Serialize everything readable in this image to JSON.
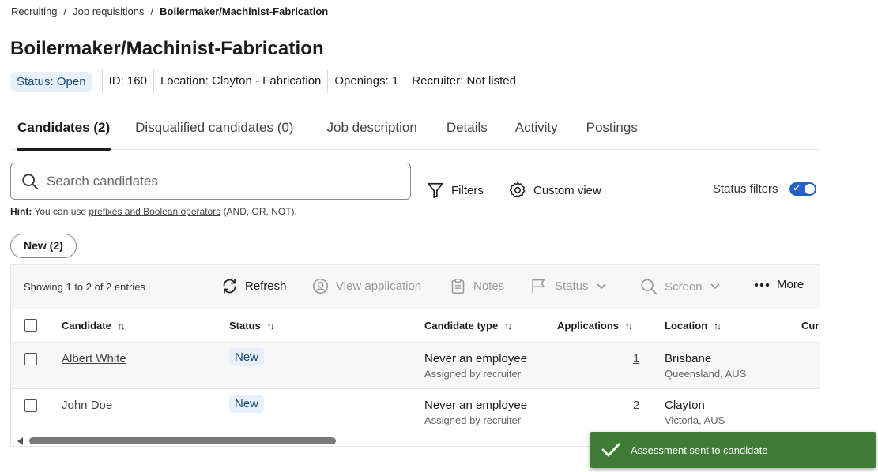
{
  "breadcrumb": {
    "items": [
      "Recruiting",
      "Job requisitions",
      "Boilermaker/Machinist-Fabrication"
    ],
    "separator": "/"
  },
  "page_title": "Boilermaker/Machinist-Fabrication",
  "meta": {
    "status": "Status: Open",
    "id": "ID: 160",
    "location": "Location: Clayton - Fabrication",
    "openings": "Openings: 1",
    "recruiter": "Recruiter: Not listed"
  },
  "tabs": [
    {
      "label": "Candidates (2)",
      "active": true
    },
    {
      "label": "Disqualified candidates (0)",
      "active": false
    },
    {
      "label": "Job description",
      "active": false
    },
    {
      "label": "Details",
      "active": false
    },
    {
      "label": "Activity",
      "active": false
    },
    {
      "label": "Postings",
      "active": false
    }
  ],
  "search": {
    "placeholder": "Search candidates",
    "value": ""
  },
  "hint": {
    "prefix": "Hint:",
    "text_before": "You can use",
    "link": "prefixes and Boolean operators",
    "text_after": "(AND, OR, NOT)."
  },
  "filters_label": "Filters",
  "custom_view_label": "Custom view",
  "status_filters": {
    "label": "Status filters",
    "enabled": true
  },
  "status_pill": "New (2)",
  "grid_toolbar": {
    "showing": "Showing 1 to 2 of 2 entries",
    "refresh": "Refresh",
    "view_application": "View application",
    "notes": "Notes",
    "status": "Status",
    "screen": "Screen",
    "more": "More"
  },
  "table": {
    "columns": [
      "Candidate",
      "Status",
      "Candidate type",
      "Applications",
      "Location",
      "Cur"
    ],
    "rows": [
      {
        "candidate": "Albert White",
        "status": "New",
        "type": "Never an employee",
        "type_sub": "Assigned by recruiter",
        "applications": "1",
        "location": "Brisbane",
        "location_sub": "Queensland, AUS"
      },
      {
        "candidate": "John Doe",
        "status": "New",
        "type": "Never an employee",
        "type_sub": "Assigned by recruiter",
        "applications": "2",
        "location": "Clayton",
        "location_sub": "Victoria, AUS"
      }
    ]
  },
  "toast": {
    "message": "Assessment sent to candidate",
    "color": "#3f7d37"
  },
  "colors": {
    "accent": "#2262c6",
    "badge_bg": "#e8f1fb",
    "badge_text": "#1a4a7a"
  }
}
